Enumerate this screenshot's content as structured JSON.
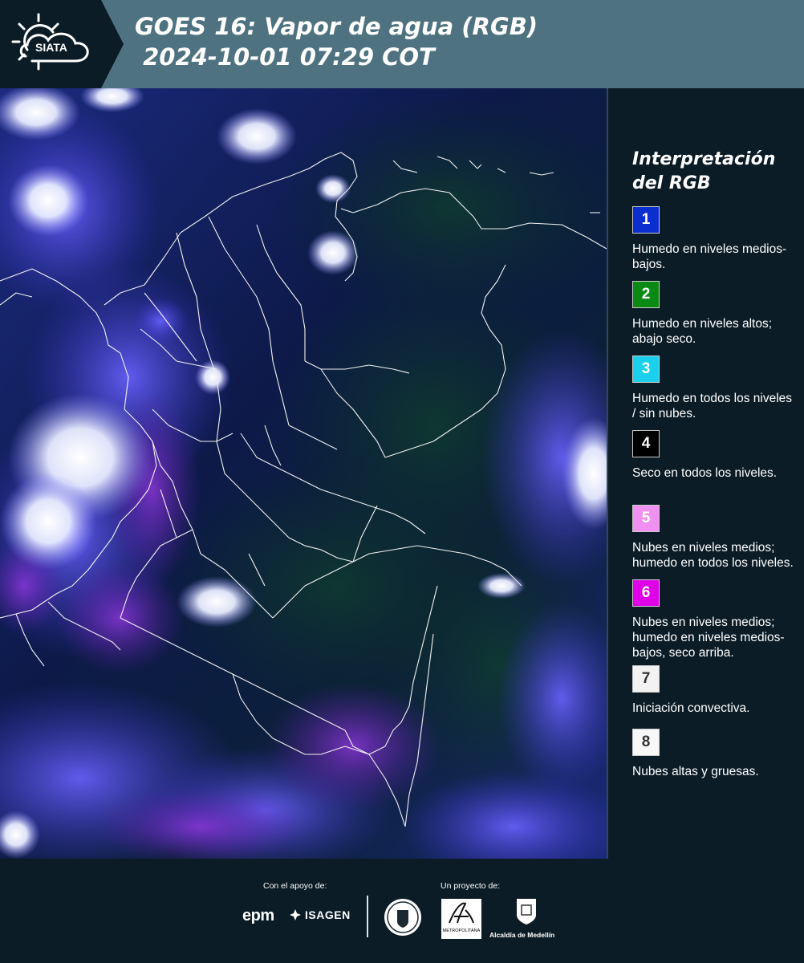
{
  "header": {
    "logo_text": "SIATA",
    "title_line1": "GOES 16: Vapor de agua (RGB)",
    "title_line2": " 2024-10-01 07:29 COT"
  },
  "legend": {
    "title": "Interpretación del RGB",
    "items": [
      {
        "number": "1",
        "color": "#0a2ecf",
        "text_color": "#ffffff",
        "label": "Humedo en niveles medios-bajos."
      },
      {
        "number": "2",
        "color": "#0a8a14",
        "text_color": "#ffffff",
        "label": "Humedo en niveles altos; abajo seco."
      },
      {
        "number": "3",
        "color": "#1ad0ec",
        "text_color": "#ffffff",
        "label": "Humedo en todos los niveles / sin nubes."
      },
      {
        "number": "4",
        "color": "#000000",
        "text_color": "#ffffff",
        "label": "Seco en todos los niveles."
      },
      {
        "number": "5",
        "color": "#f090f0",
        "text_color": "#ffffff",
        "label": "Nubes en niveles medios; humedo en todos los niveles."
      },
      {
        "number": "6",
        "color": "#e000e8",
        "text_color": "#ffffff",
        "label": "Nubes en niveles medios; humedo en niveles medios-bajos, seco arriba."
      },
      {
        "number": "7",
        "color": "#f2f2f2",
        "text_color": "#333333",
        "label": "Iniciación convectiva."
      },
      {
        "number": "8",
        "color": "#f7f7f7",
        "text_color": "#333333",
        "label": "Nubes altas y gruesas."
      }
    ]
  },
  "footer": {
    "support_label": "Con el apoyo de:",
    "project_label": "Un proyecto de:",
    "epm": "epm",
    "isagen": "ISAGEN",
    "area_caption": "METROPOLITANA",
    "alcaldia": "Alcaldía de Medellín"
  }
}
